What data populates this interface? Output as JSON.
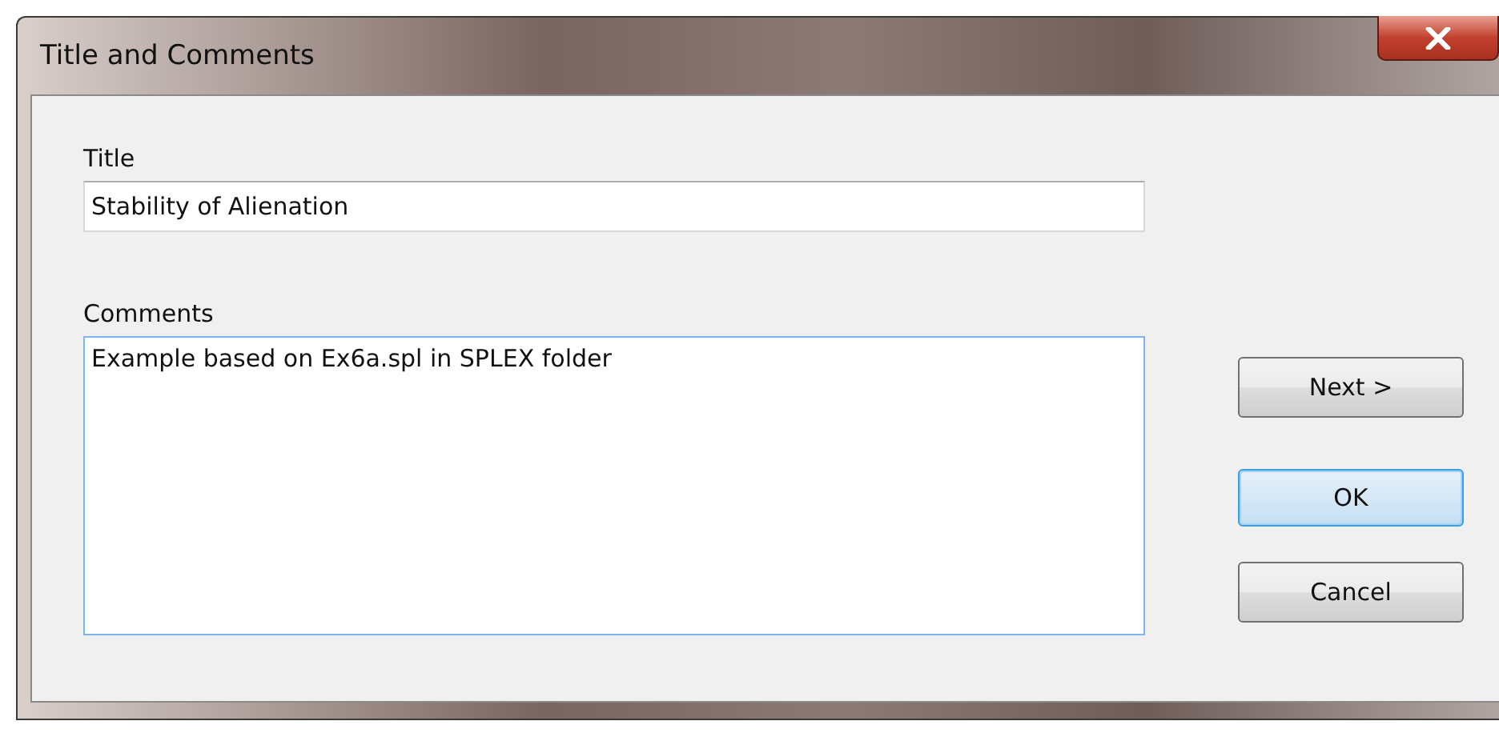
{
  "window": {
    "title": "Title and Comments"
  },
  "title_field": {
    "label": "Title",
    "value": "Stability of Alienation"
  },
  "comments_field": {
    "label": "Comments",
    "value": "Example based on Ex6a.spl in SPLEX folder"
  },
  "buttons": [
    {
      "label": "Next >",
      "default": false
    },
    {
      "label": "OK",
      "default": true
    },
    {
      "label": "Cancel",
      "default": false
    }
  ]
}
